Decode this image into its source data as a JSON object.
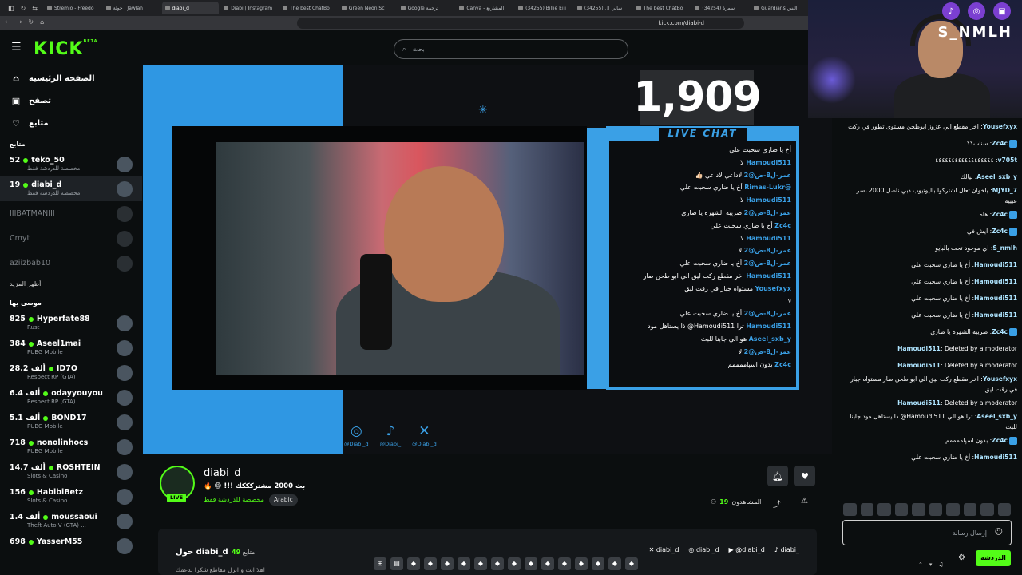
{
  "browser": {
    "tabs": [
      {
        "label": "Stremio - Freedo"
      },
      {
        "label": "جولة | Jawlah"
      },
      {
        "label": "diabi_d",
        "active": true
      },
      {
        "label": "Diabi | Instagram"
      },
      {
        "label": "The best ChatBo"
      },
      {
        "label": "Green Neon Sc"
      },
      {
        "label": "Google ترجمة"
      },
      {
        "label": "Canva - المشاريع"
      },
      {
        "label": "(34255) Billie Eili"
      },
      {
        "label": "(34255) سالي ال"
      },
      {
        "label": "The best ChatBo"
      },
      {
        "label": "(34254) سمرة"
      },
      {
        "label": "Guardians البس"
      }
    ],
    "url": "kick.com/diabi-d"
  },
  "header": {
    "logo": "KICK",
    "logo_sup": "BETA",
    "search_placeholder": "بحث"
  },
  "sidebar": {
    "nav": [
      {
        "label": "الصفحة الرئيسية",
        "icon": "home-icon"
      },
      {
        "label": "تصفح",
        "icon": "browse-icon"
      },
      {
        "label": "متابع",
        "icon": "heart-icon"
      }
    ],
    "following_label": "متابع",
    "following": [
      {
        "viewers": "52",
        "name": "teko_50",
        "category": "مخصصة للدردشة فقط",
        "live": true
      },
      {
        "viewers": "19",
        "name": "diabi_d",
        "category": "مخصصة للدردشة فقط",
        "live": true,
        "active": true
      },
      {
        "name": "IIIBATMANIII",
        "live": false
      },
      {
        "name": "Cmyt",
        "live": false
      },
      {
        "name": "aziizbab10",
        "live": false
      }
    ],
    "show_more": "أظهر المزيد",
    "recommended_label": "موصى بها",
    "recommended": [
      {
        "viewers": "825",
        "name": "Hyperfate88",
        "category": "Rust"
      },
      {
        "viewers": "384",
        "name": "Aseel1mai",
        "category": "PUBG Mobile"
      },
      {
        "viewers": "28.2 ألف",
        "name": "ID7O",
        "category": "Respect RP (GTA)"
      },
      {
        "viewers": "6.4 ألف",
        "name": "odayyouyou",
        "category": "Respect RP (GTA)"
      },
      {
        "viewers": "5.1 ألف",
        "name": "BOND17",
        "category": "PUBG Mobile"
      },
      {
        "viewers": "718",
        "name": "nonolinhocs",
        "category": "PUBG Mobile"
      },
      {
        "viewers": "14.7 ألف",
        "name": "ROSHTEIN",
        "category": "Slots & Casino"
      },
      {
        "viewers": "156",
        "name": "HabibiBetz",
        "category": "Slots & Casino"
      },
      {
        "viewers": "1.4 ألف",
        "name": "moussaoui",
        "category": "Theft Auto V (GTA) ..."
      },
      {
        "viewers": "698",
        "name": "YasserM55",
        "category": ""
      }
    ]
  },
  "video": {
    "viewer_count": "1,909",
    "overlay_title": "LIVE CHAT",
    "overlay_chat": [
      {
        "user": "",
        "text": "أخ يا ضاري سحبت علي"
      },
      {
        "user": "Hamoudi511",
        "text": "لا"
      },
      {
        "user": "عمر-ل8-ض@2",
        "text": "لاداعي لاداعي 👍🏻"
      },
      {
        "user": "@Rimas-Lukr",
        "text": "أخ يا ضاري سحبت علي"
      },
      {
        "user": "Hamoudi511",
        "text": "لا"
      },
      {
        "user": "عمر-ل8-ض@2",
        "text": "ضريبة الشهره يا ضاري"
      },
      {
        "user": "Zc4c",
        "text": "أخ يا ضاري سحبت علي"
      },
      {
        "user": "Hamoudi511",
        "text": "لا"
      },
      {
        "user": "عمر-ل8-ض@2",
        "text": "لا"
      },
      {
        "user": "عمر-ل8-ض@2",
        "text": "أخ يا ضاري سحبت علي"
      },
      {
        "user": "Hamoudi511",
        "text": "اخر مقطع ركت ليق الي ابو طحن صار"
      },
      {
        "user": "Yousefxyx",
        "text": "مستواه جبار في رقت ليق"
      },
      {
        "user": "",
        "text": "لا"
      },
      {
        "user": "عمر-ل8-ض@2",
        "text": "أخ يا ضاري سحبت علي"
      },
      {
        "user": "Hamoudi511",
        "text": "ترا Hamoudi511@ ذا يستاهل مود"
      },
      {
        "user": "Aseel_sxb_y",
        "text": "هو الي جابنا للبث"
      },
      {
        "user": "عمر-ل8-ض@2",
        "text": "لا"
      },
      {
        "user": "Zc4c",
        "text": "بدون اسپاممممم"
      }
    ],
    "socials": [
      {
        "icon": "instagram-icon",
        "glyph": "◎",
        "handle": "@Diabi_d"
      },
      {
        "icon": "tiktok-icon",
        "glyph": "♪",
        "handle": "@Diabi_"
      },
      {
        "icon": "x-icon",
        "glyph": "✕",
        "handle": "@Diabi_d"
      }
    ]
  },
  "stream": {
    "streamer": "diabi_d",
    "live_label": "LIVE",
    "title": "🔥 😡 !!! بث 2000 مشتركككك",
    "category": "مخصصة للدردشة فقط",
    "language": "Arabic",
    "viewers_label": "المشاهدون",
    "viewers": "19"
  },
  "about": {
    "title": "حول diabi_d",
    "followers_count": "49",
    "followers_label": "متابع",
    "description": "اهلا ابث و انزل مقاطع شكرا لدعمك",
    "socials": [
      "diabi_d",
      "diabi_d",
      "@diabi_d",
      "diabi_"
    ]
  },
  "webcam": {
    "brand": "S_NMLH"
  },
  "chat": {
    "messages": [
      {
        "user": "Yousefxyx",
        "text": "اخر مقطع الي عزوز ابوطحن مستوى تطور في ركت",
        "badge": false
      },
      {
        "user": "Zc4c",
        "text": "سناب؟؟",
        "badge": true
      },
      {
        "user": "v705t",
        "text": "٤٤٤٤٤٤٤٤٤٤٤٤٤٤٤٤٤٤",
        "badge": false
      },
      {
        "user": "Aseel_sxb_y",
        "text": "بيالك",
        "badge": false
      },
      {
        "user": "MJYD_7",
        "text": "ياخوان تعال اشتركوا باليوتيوب دبي ناصل 2000 بسر عيييه",
        "badge": false
      },
      {
        "user": "Zc4c",
        "text": "هاه",
        "badge": true
      },
      {
        "user": "Zc4c",
        "text": "ايش في",
        "badge": true
      },
      {
        "user": "S_nmlh",
        "text": "اي موجود تحت بالبايو",
        "badge": false
      },
      {
        "user": "Hamoudi511",
        "text": "أخ يا ضاري سحبت علي",
        "badge": false
      },
      {
        "user": "Hamoudi511",
        "text": "أخ يا ضاري سحبت علي",
        "badge": false
      },
      {
        "user": "Hamoudi511",
        "text": "أخ يا ضاري سحبت علي",
        "badge": false
      },
      {
        "user": "Hamoudi511",
        "text": "أخ يا ضاري سحبت علي",
        "badge": false
      },
      {
        "user": "Zc4c",
        "text": "ضريبة الشهره يا ضاري",
        "badge": true
      },
      {
        "user": "Hamoudi511",
        "text": "Deleted by a moderator",
        "badge": false
      },
      {
        "user": "Hamoudi511",
        "text": "Deleted by a moderator",
        "badge": false
      },
      {
        "user": "Yousefxyx",
        "text": "اخر مقطع ركت ليق الي ابو طحن صار مستواه جبار في رقت ليق",
        "badge": false
      },
      {
        "user": "Hamoudi511",
        "text": "Deleted by a moderator",
        "badge": false
      },
      {
        "user": "Aseel_sxb_y",
        "text": "ترا هو الي Hamoudi511@ ذا يستاهل مود جابنا للبث",
        "badge": false
      },
      {
        "user": "Zc4c",
        "text": "بدون اسپاممممم",
        "badge": true
      },
      {
        "user": "Hamoudi511",
        "text": "أخ يا ضاري سحبت علي",
        "badge": false
      }
    ],
    "input_placeholder": "إرسال رسالة",
    "send_label": "الدردشة"
  },
  "colors": {
    "kick_green": "#53fc18",
    "overlay_blue": "#3aa0e6"
  }
}
